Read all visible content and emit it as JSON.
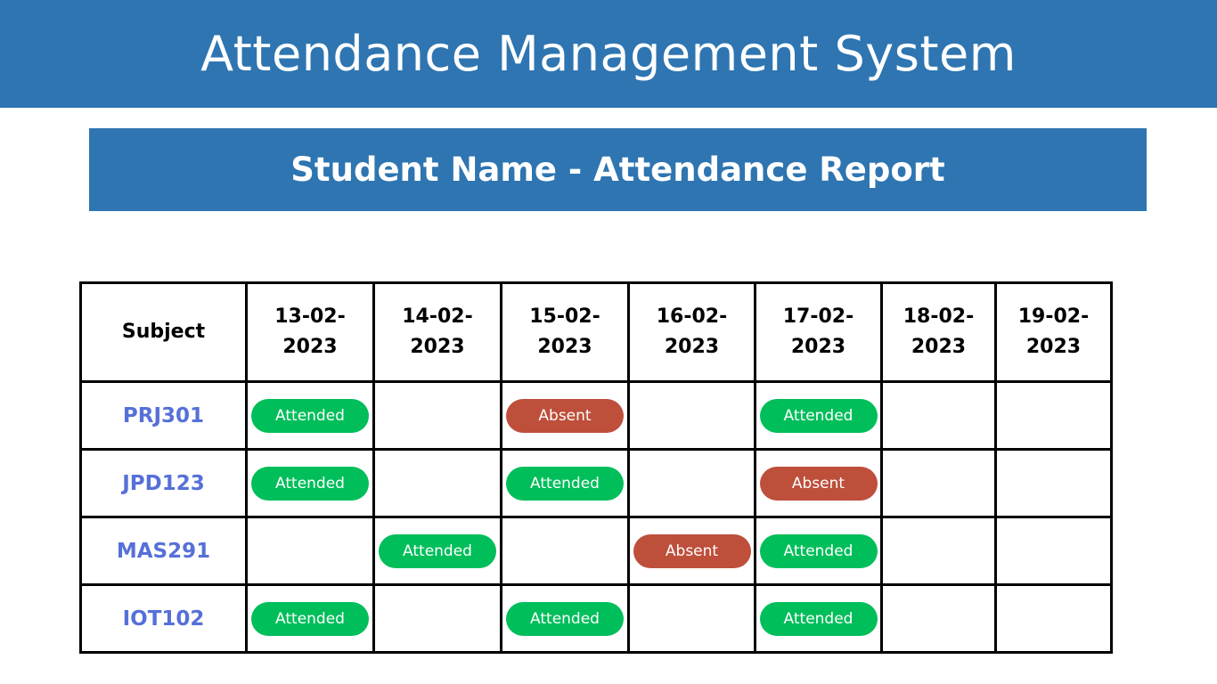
{
  "header": {
    "title": "Attendance Management System"
  },
  "report": {
    "title": "Student Name - Attendance Report"
  },
  "table": {
    "subject_header": "Subject",
    "dates": [
      "13-02-2023",
      "14-02-2023",
      "15-02-2023",
      "16-02-2023",
      "17-02-2023",
      "18-02-2023",
      "19-02-2023"
    ],
    "rows": [
      {
        "subject": "PRJ301",
        "statuses": [
          "Attended",
          "",
          "Absent",
          "",
          "Attended",
          "",
          ""
        ]
      },
      {
        "subject": "JPD123",
        "statuses": [
          "Attended",
          "",
          "Attended",
          "",
          "Absent",
          "",
          ""
        ]
      },
      {
        "subject": "MAS291",
        "statuses": [
          "",
          "Attended",
          "",
          "Absent",
          "Attended",
          "",
          ""
        ]
      },
      {
        "subject": "IOT102",
        "statuses": [
          "Attended",
          "",
          "Attended",
          "",
          "Attended",
          "",
          ""
        ]
      }
    ]
  },
  "colors": {
    "brand": "#2e75b1",
    "attended": "#00be5a",
    "absent": "#bd4f3b",
    "subject_text": "#5670d8"
  }
}
